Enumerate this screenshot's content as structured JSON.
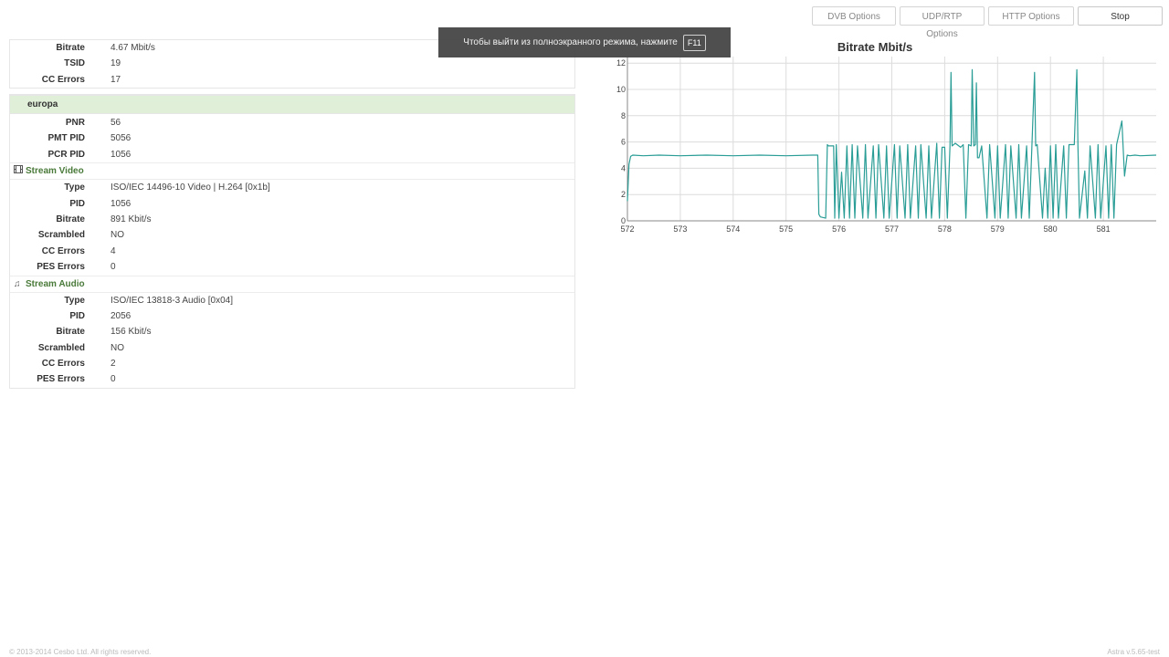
{
  "toolbar": {
    "dvb": "DVB Options",
    "udp": "UDP/RTP Options",
    "http": "HTTP Options",
    "stop": "Stop"
  },
  "fullscreen_notice": {
    "text": "Чтобы выйти из полноэкранного режима, нажмите",
    "key": "F11"
  },
  "stream_info": [
    {
      "label": "Bitrate",
      "value": "4.67 Mbit/s"
    },
    {
      "label": "TSID",
      "value": "19"
    },
    {
      "label": "CC Errors",
      "value": "17"
    }
  ],
  "program": {
    "name": "europa",
    "fields": [
      {
        "label": "PNR",
        "value": "56"
      },
      {
        "label": "PMT PID",
        "value": "5056"
      },
      {
        "label": "PCR PID",
        "value": "1056"
      }
    ]
  },
  "video": {
    "title": "Stream Video",
    "icon": "film-icon",
    "fields": [
      {
        "label": "Type",
        "value": "ISO/IEC 14496-10 Video | H.264 [0x1b]"
      },
      {
        "label": "PID",
        "value": "1056"
      },
      {
        "label": "Bitrate",
        "value": "891 Kbit/s"
      },
      {
        "label": "Scrambled",
        "value": "NO"
      },
      {
        "label": "CC Errors",
        "value": "4"
      },
      {
        "label": "PES Errors",
        "value": "0"
      }
    ]
  },
  "audio": {
    "title": "Stream Audio",
    "icon": "music-note-icon",
    "fields": [
      {
        "label": "Type",
        "value": "ISO/IEC 13818-3 Audio [0x04]"
      },
      {
        "label": "PID",
        "value": "2056"
      },
      {
        "label": "Bitrate",
        "value": "156 Kbit/s"
      },
      {
        "label": "Scrambled",
        "value": "NO"
      },
      {
        "label": "CC Errors",
        "value": "2"
      },
      {
        "label": "PES Errors",
        "value": "0"
      }
    ]
  },
  "chart_data": {
    "type": "line",
    "title": "Bitrate Mbit/s",
    "xlim": [
      572,
      582
    ],
    "ylim": [
      0,
      12.5
    ],
    "xticks": [
      572,
      573,
      574,
      575,
      576,
      577,
      578,
      579,
      580,
      581
    ],
    "yticks": [
      0,
      2,
      4,
      6,
      8,
      10,
      12
    ],
    "grid": true,
    "color": "#2a9d96",
    "series": [
      {
        "x": [
          572.0,
          572.03,
          572.06,
          572.1,
          572.3,
          572.6,
          573.0,
          573.5,
          574.0,
          574.5,
          575.0,
          575.5,
          575.6,
          575.62,
          575.65,
          575.75,
          575.78,
          575.8,
          575.9,
          575.92,
          575.95,
          576.0,
          576.05,
          576.1,
          576.15,
          576.2,
          576.25,
          576.3,
          576.35,
          576.45,
          576.5,
          576.55,
          576.65,
          576.7,
          576.75,
          576.85,
          576.9,
          576.95,
          577.05,
          577.1,
          577.15,
          577.25,
          577.3,
          577.35,
          577.45,
          577.5,
          577.55,
          577.65,
          577.7,
          577.75,
          577.85,
          577.9,
          577.95,
          578.0,
          578.05,
          578.1,
          578.12,
          578.14,
          578.2,
          578.3,
          578.35,
          578.4,
          578.45,
          578.5,
          578.52,
          578.55,
          578.58,
          578.6,
          578.62,
          578.65,
          578.7,
          578.8,
          578.85,
          578.95,
          579.0,
          579.05,
          579.15,
          579.2,
          579.25,
          579.35,
          579.4,
          579.45,
          579.55,
          579.6,
          579.65,
          579.7,
          579.72,
          579.75,
          579.85,
          579.9,
          579.95,
          580.0,
          580.05,
          580.1,
          580.15,
          580.25,
          580.3,
          580.35,
          580.45,
          580.5,
          580.52,
          580.55,
          580.65,
          580.7,
          580.75,
          580.85,
          580.9,
          580.95,
          581.05,
          581.1,
          581.15,
          581.2,
          581.25,
          581.35,
          581.4,
          581.45,
          581.5,
          581.6,
          581.7,
          582.0
        ],
        "y": [
          1.5,
          4.3,
          4.9,
          5.0,
          4.95,
          5.0,
          4.95,
          5.0,
          4.95,
          5.0,
          4.95,
          5.0,
          5.0,
          0.5,
          0.3,
          0.2,
          5.8,
          5.7,
          5.7,
          0.2,
          5.8,
          0.2,
          3.7,
          0.2,
          5.7,
          0.2,
          5.8,
          0.2,
          5.7,
          0.2,
          5.8,
          0.2,
          5.7,
          0.2,
          5.8,
          0.2,
          5.7,
          0.2,
          5.8,
          0.2,
          5.7,
          0.2,
          5.8,
          0.2,
          5.7,
          0.2,
          5.8,
          0.2,
          5.7,
          0.2,
          5.9,
          0.2,
          5.6,
          5.6,
          0.2,
          5.7,
          11.3,
          5.7,
          5.9,
          5.6,
          5.8,
          0.2,
          5.8,
          5.7,
          11.5,
          5.7,
          5.8,
          10.5,
          4.8,
          4.8,
          5.7,
          0.2,
          5.8,
          0.2,
          5.7,
          0.2,
          5.8,
          0.2,
          5.7,
          0.2,
          5.8,
          0.2,
          5.7,
          0.2,
          5.7,
          11.3,
          5.7,
          5.8,
          0.2,
          4.0,
          0.2,
          5.7,
          0.2,
          5.8,
          0.2,
          5.7,
          0.2,
          5.8,
          5.8,
          11.5,
          5.7,
          0.2,
          3.8,
          0.2,
          5.7,
          0.2,
          5.8,
          0.2,
          5.7,
          0.2,
          5.8,
          0.2,
          5.8,
          7.6,
          3.4,
          5.0,
          4.95,
          5.0,
          4.95,
          5.0
        ]
      }
    ]
  },
  "footer": {
    "copyright": "© 2013-2014 Cesbo Ltd. All rights reserved.",
    "version": "Astra v.5.65-test"
  }
}
